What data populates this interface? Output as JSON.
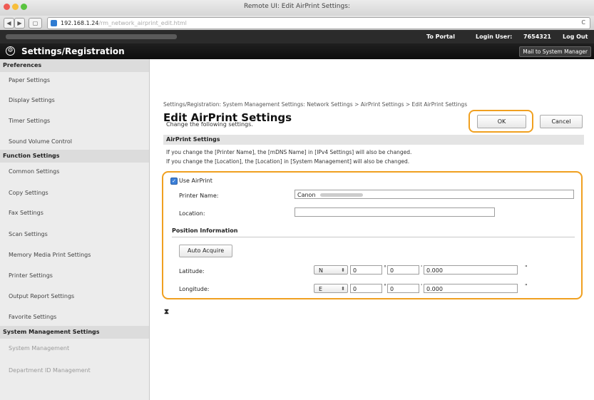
{
  "window": {
    "title": "Remote UI: Edit AirPrint Settings:"
  },
  "address_bar": {
    "back": "◀",
    "forward": "▶",
    "tabs": "▢",
    "url_host": "192.168.1.24",
    "url_path": "/rm_network_airprint_edit.html",
    "reload": "C"
  },
  "top_bar": {
    "to_portal": "To Portal",
    "login_user_label": "Login User:",
    "login_user_id": "7654321",
    "log_out": "Log Out"
  },
  "header": {
    "title": "Settings/Registration",
    "mail_button": "Mail to System Manager",
    "gear_glyph": "⚙"
  },
  "sidebar": {
    "preferences": {
      "heading": "Preferences",
      "items": [
        "Paper Settings",
        "Display Settings",
        "Timer Settings",
        "Sound Volume Control"
      ]
    },
    "function_settings": {
      "heading": "Function Settings",
      "items": [
        "Common Settings",
        "Copy Settings",
        "Fax Settings",
        "Scan Settings",
        "Memory Media Print Settings",
        "Printer Settings",
        "Output Report Settings",
        "Favorite Settings"
      ]
    },
    "system_management": {
      "heading": "System Management Settings",
      "items": [
        "System Management",
        "Department ID Management"
      ]
    }
  },
  "main": {
    "breadcrumb": "Settings/Registration: System Management Settings: Network Settings > AirPrint Settings > Edit AirPrint Settings",
    "page_title": "Edit AirPrint Settings",
    "change_text": "Change the following settings.",
    "ok_label": "OK",
    "cancel_label": "Cancel",
    "section_title": "AirPrint Settings",
    "note1": "If you change the [Printer Name], the [mDNS Name] in [IPv4 Settings] will also be changed.",
    "note2": "If you change the [Location], the [Location] in [System Management] will also be changed.",
    "use_airprint_label": "Use AirPrint",
    "use_airprint_checked": true,
    "printer_name_label": "Printer Name:",
    "printer_name_value": "Canon",
    "location_label": "Location:",
    "location_value": "",
    "position_title": "Position Information",
    "auto_acquire_label": "Auto Acquire",
    "latitude": {
      "label": "Latitude:",
      "dir": "N",
      "deg": "0",
      "min": "0",
      "sec": "0.000"
    },
    "longitude": {
      "label": "Longitude:",
      "dir": "E",
      "deg": "0",
      "min": "0",
      "sec": "0.000"
    },
    "deg_sym": "°",
    "min_sym": "'",
    "sec_sym": "\"",
    "to_top": "⧗"
  },
  "colors": {
    "highlight": "#f0a020",
    "header_bg": "#111111",
    "sidebar_bg": "#ececec"
  }
}
